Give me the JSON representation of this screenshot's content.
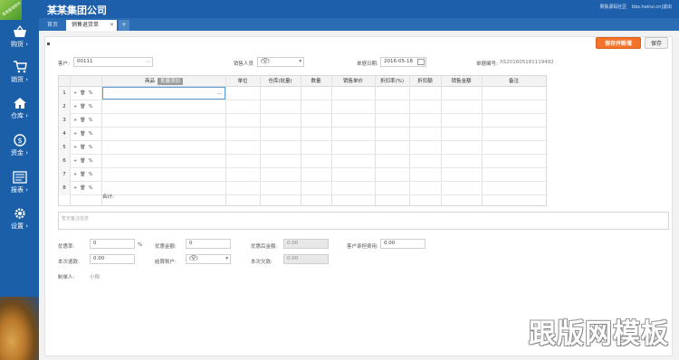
{
  "sidebar": {
    "logo_text": "某某管理软件",
    "items": [
      {
        "label": "购货",
        "icon": "shopping-basket-icon"
      },
      {
        "label": "销货",
        "icon": "cart-icon"
      },
      {
        "label": "仓库",
        "icon": "home-icon"
      },
      {
        "label": "资金",
        "icon": "dollar-circle-icon"
      },
      {
        "label": "报表",
        "icon": "report-icon"
      },
      {
        "label": "设置",
        "icon": "gear-icon"
      }
    ]
  },
  "header": {
    "company": "某某集团公司",
    "links": [
      "果肤源码社区",
      "bbs.heirui.cn|退出"
    ]
  },
  "tabs": {
    "home": "首页",
    "active": "销售退货单",
    "close": "×",
    "add": "+"
  },
  "toolbar": {
    "save_new": "保存并新增",
    "save": "保存"
  },
  "form": {
    "customer_label": "客户:",
    "customer_value": "00111",
    "customer_more": "...",
    "sales_label": "销售人员",
    "sales_value": "(空)",
    "date_label": "单据日期:",
    "date_value": "2016-05-18",
    "docno_label": "单据编号:",
    "docno_value": "XS201605181119492"
  },
  "grid": {
    "headers": [
      "商品",
      "单位",
      "仓库(批量)",
      "数量",
      "销售单价",
      "折扣率(%)",
      "折扣额",
      "销售金额",
      "备注"
    ],
    "batch_tag": "批量添加",
    "row_numbers": [
      "1",
      "2",
      "3",
      "4",
      "5",
      "6",
      "7",
      "8"
    ],
    "ops": [
      "+",
      "🗑",
      "%"
    ],
    "active_more": "...",
    "total_label": "合计:"
  },
  "remark": {
    "placeholder": "暂无备注信息"
  },
  "footer": {
    "discount_rate_label": "优惠率:",
    "discount_rate_value": "0",
    "percent": "%",
    "discount_amount_label": "优惠金额:",
    "discount_amount_value": "0",
    "after_discount_label": "优惠后金额:",
    "after_discount_value": "0.00",
    "customer_fee_label": "客户承担费用:",
    "customer_fee_value": "0.00",
    "refund_label": "本次退款:",
    "refund_value": "0.00",
    "settle_label": "结算账户:",
    "settle_value": "(空)",
    "arrears_label": "本次欠款:",
    "arrears_value": "0.00",
    "maker_label": "制单人:",
    "maker_value": "小阳"
  },
  "watermark": "跟版网模板",
  "colors": {
    "sidebar": "#1b5fa8",
    "accent": "#f4732b"
  }
}
